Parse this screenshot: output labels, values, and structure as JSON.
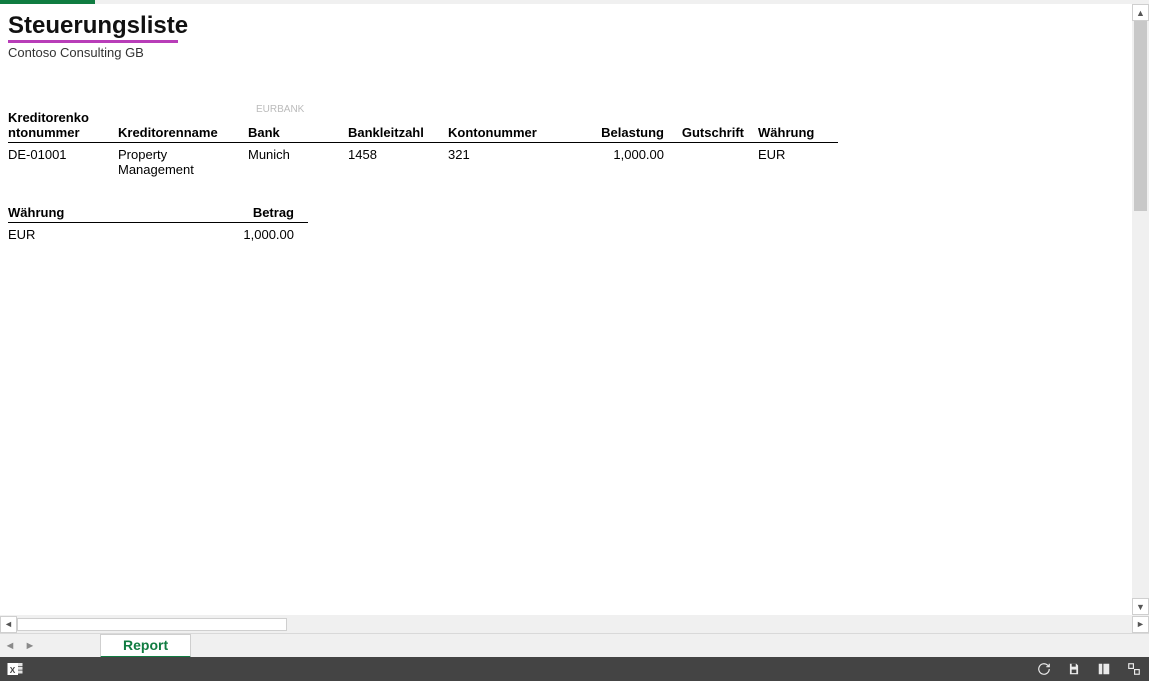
{
  "title": "Steuerungsliste",
  "subtitle": "Contoso Consulting GB",
  "ghost_bank": "EURBANK",
  "table1": {
    "headers": {
      "kknr": "Kreditorenko\nntonummer",
      "kname": "Kreditorenname",
      "bank": "Bank",
      "blz": "Bankleitzahl",
      "knr": "Kontonummer",
      "bel": "Belastung",
      "gut": "Gutschrift",
      "wae": "Währung"
    },
    "rows": [
      {
        "kknr": "DE-01001",
        "kname": "Property Management",
        "bank": "Munich",
        "blz": "1458",
        "knr": "321",
        "bel": "1,000.00",
        "gut": "",
        "wae": "EUR"
      }
    ]
  },
  "table2": {
    "headers": {
      "wae": "Währung",
      "betrag": "Betrag"
    },
    "rows": [
      {
        "wae": "EUR",
        "betrag": "1,000.00"
      }
    ]
  },
  "tab_label": "Report"
}
